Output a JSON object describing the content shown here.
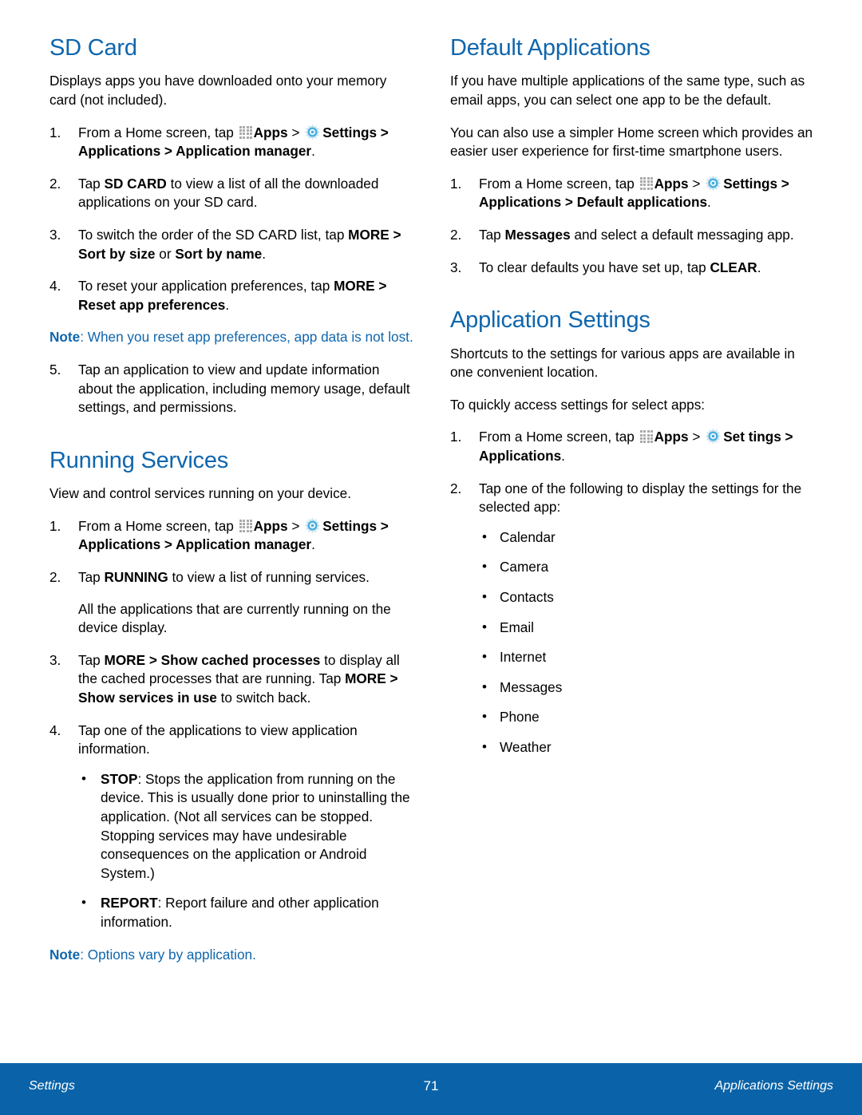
{
  "colors": {
    "heading_blue": "#0f66ad",
    "note_blue": "#0f66ad",
    "footer_blue": "#0a63a8",
    "apps_icon_gray": "#a8a8a8",
    "gear_icon_blue": "#4aaede"
  },
  "icons": {
    "apps": "apps-grid-icon",
    "settings": "gear-icon"
  },
  "left_column": {
    "sd_card": {
      "title": "SD Card",
      "intro": "Displays apps you have downloaded onto your memory card (not included).",
      "steps": [
        {
          "num": "1.",
          "parts": [
            {
              "t": "From a Home screen, tap ",
              "b": false
            },
            {
              "icon": "apps"
            },
            {
              "t": "Apps",
              "b": true
            },
            {
              "t": " > ",
              "b": false
            },
            {
              "icon": "settings"
            },
            {
              "t": "Settings > Applications > Application manager",
              "b": true
            },
            {
              "t": ".",
              "b": false
            }
          ]
        },
        {
          "num": "2.",
          "parts": [
            {
              "t": "Tap ",
              "b": false
            },
            {
              "t": "SD CARD",
              "b": true
            },
            {
              "t": " to view a list of all the downloaded applications on your SD card.",
              "b": false
            }
          ]
        },
        {
          "num": "3.",
          "parts": [
            {
              "t": "To switch the order of the SD CARD list, tap ",
              "b": false
            },
            {
              "t": "MORE",
              "b": true
            },
            {
              "t": " > ",
              "b": true
            },
            {
              "t": "Sort by size",
              "b": true
            },
            {
              "t": " or ",
              "b": false
            },
            {
              "t": "Sort by name",
              "b": true
            },
            {
              "t": ".",
              "b": false
            }
          ]
        },
        {
          "num": "4.",
          "parts": [
            {
              "t": "To reset your application preferences, tap ",
              "b": false
            },
            {
              "t": "MORE",
              "b": true
            },
            {
              "t": " > ",
              "b": true
            },
            {
              "t": "Reset app preferences",
              "b": true
            },
            {
              "t": ".",
              "b": false
            }
          ]
        }
      ],
      "note": {
        "label": "Note",
        "text": ": When you reset app preferences, app data is not lost."
      },
      "step5": {
        "num": "5.",
        "text": "Tap an application to view and update information about the application, including memory usage, default settings, and permissions."
      }
    },
    "running_services": {
      "title": "Running Services",
      "intro": "View and control services running on your device.",
      "steps": [
        {
          "num": "1.",
          "parts": [
            {
              "t": "From a Home screen, tap ",
              "b": false
            },
            {
              "icon": "apps"
            },
            {
              "t": "Apps",
              "b": true
            },
            {
              "t": " > ",
              "b": false
            },
            {
              "icon": "settings"
            },
            {
              "t": "Settings > Applications > Application manager",
              "b": true
            },
            {
              "t": ".",
              "b": false
            }
          ]
        },
        {
          "num": "2.",
          "parts": [
            {
              "t": "Tap ",
              "b": false
            },
            {
              "t": "RUNNING",
              "b": true
            },
            {
              "t": " to view a list of running services.",
              "b": false
            }
          ],
          "sub": "All the applications that are currently running on the device display."
        },
        {
          "num": "3.",
          "parts": [
            {
              "t": "Tap ",
              "b": false
            },
            {
              "t": "MORE",
              "b": true
            },
            {
              "t": " > ",
              "b": true
            },
            {
              "t": "Show cached processes",
              "b": true
            },
            {
              "t": " to display all the cached processes that are running. Tap ",
              "b": false
            },
            {
              "t": "MORE",
              "b": true
            },
            {
              "t": " > ",
              "b": true
            },
            {
              "t": "Show services in use",
              "b": true
            },
            {
              "t": " to switch back.",
              "b": false
            }
          ]
        },
        {
          "num": "4.",
          "parts": [
            {
              "t": "Tap one of the applications to view application information.",
              "b": false
            }
          ]
        }
      ],
      "bullets": [
        {
          "label": "STOP",
          "text": ": Stops the application from running on the device. This is usually done prior to uninstalling the application. (Not all services can be stopped. Stopping services may have undesirable consequences on the application or Android System.)"
        },
        {
          "label": "REPORT",
          "text": ": Report failure and other application information."
        }
      ],
      "note": {
        "label": "Note",
        "text": ": Options vary by application."
      }
    }
  },
  "right_column": {
    "default_applications": {
      "title": "Default Applications",
      "intro1": "If you have multiple applications of the same type, such as email apps, you can select one app to be the default.",
      "intro2": "You can also use a simpler Home screen which provides an easier user experience for first-time smartphone users.",
      "steps": [
        {
          "num": "1.",
          "parts": [
            {
              "t": "From a Home screen, tap ",
              "b": false
            },
            {
              "icon": "apps"
            },
            {
              "t": "Apps",
              "b": true
            },
            {
              "t": " > ",
              "b": false
            },
            {
              "icon": "settings"
            },
            {
              "t": "Settings > Applications > Default applications",
              "b": true
            },
            {
              "t": ".",
              "b": false
            }
          ]
        },
        {
          "num": "2.",
          "parts": [
            {
              "t": "Tap ",
              "b": false
            },
            {
              "t": "Messages",
              "b": true
            },
            {
              "t": " and select a default messaging app.",
              "b": false
            }
          ]
        },
        {
          "num": "3.",
          "parts": [
            {
              "t": "To clear defaults you have set up, tap ",
              "b": false
            },
            {
              "t": "CLEAR",
              "b": true
            },
            {
              "t": ".",
              "b": false
            }
          ]
        }
      ]
    },
    "application_settings": {
      "title": "Application Settings",
      "intro1": "Shortcuts to the settings for various apps are available in one convenient location.",
      "intro2": "To quickly access settings for select apps:",
      "steps": [
        {
          "num": "1.",
          "parts": [
            {
              "t": "From a Home screen, tap ",
              "b": false
            },
            {
              "icon": "apps"
            },
            {
              "t": "Apps",
              "b": true
            },
            {
              "t": " > ",
              "b": false
            },
            {
              "icon": "settings"
            },
            {
              "t": "Set tings > Applications",
              "b": true
            },
            {
              "t": ".",
              "b": false
            }
          ]
        },
        {
          "num": "2.",
          "parts": [
            {
              "t": "Tap one of the following to display the settings for the selected app:",
              "b": false
            }
          ]
        }
      ],
      "app_list": [
        "Calendar",
        "Camera",
        "Contacts",
        "Email",
        "Internet",
        "Messages",
        "Phone",
        "Weather"
      ]
    }
  },
  "footer": {
    "left": "Settings",
    "page_number": "71",
    "right": "Applications Settings"
  }
}
